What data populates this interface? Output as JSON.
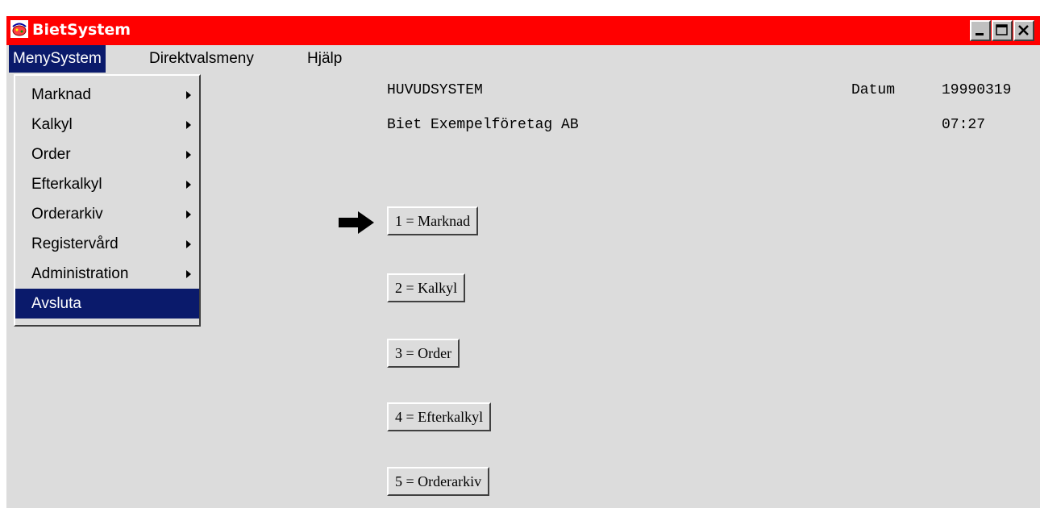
{
  "window": {
    "title": "BietSystem",
    "controls": {
      "minimize_icon": "minimize-icon",
      "maximize_icon": "maximize-icon",
      "close_icon": "close-icon"
    }
  },
  "menubar": {
    "items": [
      {
        "label": "MenySystem",
        "active": true
      },
      {
        "label": "Direktvalsmeny",
        "active": false
      },
      {
        "label": "Hjälp",
        "active": false
      }
    ]
  },
  "dropdown": {
    "items": [
      {
        "label": "Marknad",
        "submenu": true
      },
      {
        "label": "Kalkyl",
        "submenu": true
      },
      {
        "label": "Order",
        "submenu": true
      },
      {
        "label": "Efterkalkyl",
        "submenu": true
      },
      {
        "label": "Orderarkiv",
        "submenu": true
      },
      {
        "label": "Registervård",
        "submenu": true
      },
      {
        "label": "Administration",
        "submenu": true
      },
      {
        "label": "Avsluta",
        "submenu": false,
        "highlighted": true
      }
    ]
  },
  "header": {
    "system_title": "HUVUDSYSTEM",
    "company": "Biet Exempelföretag AB",
    "date_label": "Datum",
    "date_value": "19990319",
    "time_value": "07:27"
  },
  "main": {
    "pointer_icon": "arrow-right-icon",
    "buttons": [
      {
        "label": "1 = Marknad"
      },
      {
        "label": "2 = Kalkyl"
      },
      {
        "label": "3 = Order"
      },
      {
        "label": "4 = Efterkalkyl"
      },
      {
        "label": "5 = Orderarkiv"
      }
    ]
  },
  "colors": {
    "titlebar": "#ff0000",
    "selection": "#0a1a6b",
    "background": "#dcdcdc"
  }
}
